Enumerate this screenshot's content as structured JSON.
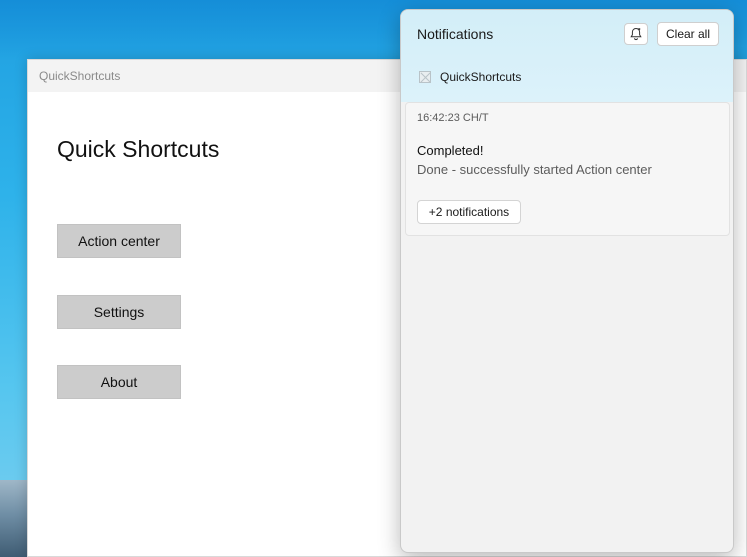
{
  "app": {
    "window_title": "QuickShortcuts",
    "page_title": "Quick Shortcuts",
    "buttons": {
      "action_center": "Action center",
      "settings": "Settings",
      "about": "About"
    }
  },
  "notifications": {
    "panel_title": "Notifications",
    "focus_assist_icon": "bell-settings-icon",
    "clear_all_label": "Clear all",
    "group": {
      "app_name": "QuickShortcuts",
      "app_icon": "broken-image-icon"
    },
    "item": {
      "time": "16:42:23 CH/T",
      "title": "Completed!",
      "body": "Done - successfully started Action center",
      "more_label": "+2 notifications"
    }
  },
  "colors": {
    "desktop_blue": "#2eb2ea",
    "button_gray": "#cccccc",
    "notification_header": "#d3eef8"
  }
}
